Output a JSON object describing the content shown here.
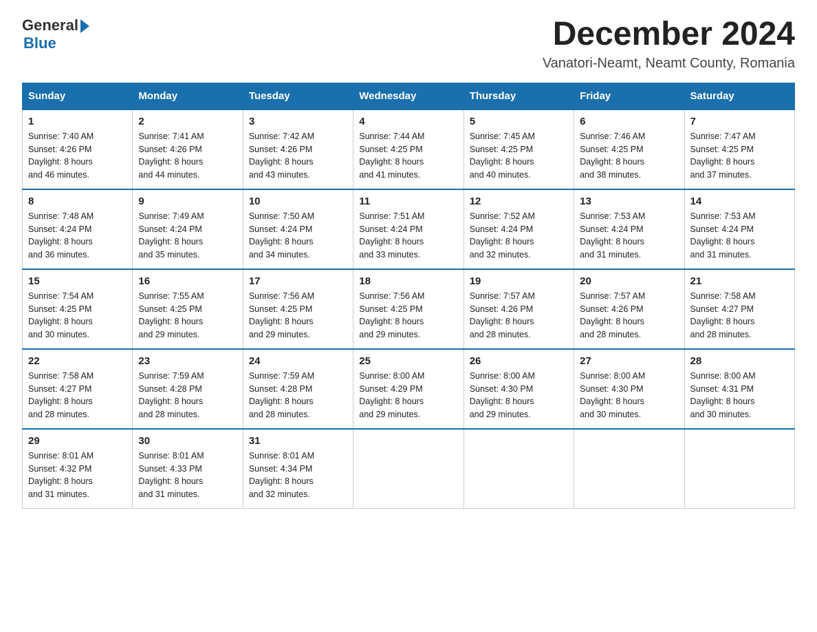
{
  "logo": {
    "text_general": "General",
    "arrow": "▶",
    "text_blue": "Blue"
  },
  "title": "December 2024",
  "subtitle": "Vanatori-Neamt, Neamt County, Romania",
  "days_of_week": [
    "Sunday",
    "Monday",
    "Tuesday",
    "Wednesday",
    "Thursday",
    "Friday",
    "Saturday"
  ],
  "weeks": [
    [
      {
        "day": "1",
        "info": "Sunrise: 7:40 AM\nSunset: 4:26 PM\nDaylight: 8 hours\nand 46 minutes."
      },
      {
        "day": "2",
        "info": "Sunrise: 7:41 AM\nSunset: 4:26 PM\nDaylight: 8 hours\nand 44 minutes."
      },
      {
        "day": "3",
        "info": "Sunrise: 7:42 AM\nSunset: 4:26 PM\nDaylight: 8 hours\nand 43 minutes."
      },
      {
        "day": "4",
        "info": "Sunrise: 7:44 AM\nSunset: 4:25 PM\nDaylight: 8 hours\nand 41 minutes."
      },
      {
        "day": "5",
        "info": "Sunrise: 7:45 AM\nSunset: 4:25 PM\nDaylight: 8 hours\nand 40 minutes."
      },
      {
        "day": "6",
        "info": "Sunrise: 7:46 AM\nSunset: 4:25 PM\nDaylight: 8 hours\nand 38 minutes."
      },
      {
        "day": "7",
        "info": "Sunrise: 7:47 AM\nSunset: 4:25 PM\nDaylight: 8 hours\nand 37 minutes."
      }
    ],
    [
      {
        "day": "8",
        "info": "Sunrise: 7:48 AM\nSunset: 4:24 PM\nDaylight: 8 hours\nand 36 minutes."
      },
      {
        "day": "9",
        "info": "Sunrise: 7:49 AM\nSunset: 4:24 PM\nDaylight: 8 hours\nand 35 minutes."
      },
      {
        "day": "10",
        "info": "Sunrise: 7:50 AM\nSunset: 4:24 PM\nDaylight: 8 hours\nand 34 minutes."
      },
      {
        "day": "11",
        "info": "Sunrise: 7:51 AM\nSunset: 4:24 PM\nDaylight: 8 hours\nand 33 minutes."
      },
      {
        "day": "12",
        "info": "Sunrise: 7:52 AM\nSunset: 4:24 PM\nDaylight: 8 hours\nand 32 minutes."
      },
      {
        "day": "13",
        "info": "Sunrise: 7:53 AM\nSunset: 4:24 PM\nDaylight: 8 hours\nand 31 minutes."
      },
      {
        "day": "14",
        "info": "Sunrise: 7:53 AM\nSunset: 4:24 PM\nDaylight: 8 hours\nand 31 minutes."
      }
    ],
    [
      {
        "day": "15",
        "info": "Sunrise: 7:54 AM\nSunset: 4:25 PM\nDaylight: 8 hours\nand 30 minutes."
      },
      {
        "day": "16",
        "info": "Sunrise: 7:55 AM\nSunset: 4:25 PM\nDaylight: 8 hours\nand 29 minutes."
      },
      {
        "day": "17",
        "info": "Sunrise: 7:56 AM\nSunset: 4:25 PM\nDaylight: 8 hours\nand 29 minutes."
      },
      {
        "day": "18",
        "info": "Sunrise: 7:56 AM\nSunset: 4:25 PM\nDaylight: 8 hours\nand 29 minutes."
      },
      {
        "day": "19",
        "info": "Sunrise: 7:57 AM\nSunset: 4:26 PM\nDaylight: 8 hours\nand 28 minutes."
      },
      {
        "day": "20",
        "info": "Sunrise: 7:57 AM\nSunset: 4:26 PM\nDaylight: 8 hours\nand 28 minutes."
      },
      {
        "day": "21",
        "info": "Sunrise: 7:58 AM\nSunset: 4:27 PM\nDaylight: 8 hours\nand 28 minutes."
      }
    ],
    [
      {
        "day": "22",
        "info": "Sunrise: 7:58 AM\nSunset: 4:27 PM\nDaylight: 8 hours\nand 28 minutes."
      },
      {
        "day": "23",
        "info": "Sunrise: 7:59 AM\nSunset: 4:28 PM\nDaylight: 8 hours\nand 28 minutes."
      },
      {
        "day": "24",
        "info": "Sunrise: 7:59 AM\nSunset: 4:28 PM\nDaylight: 8 hours\nand 28 minutes."
      },
      {
        "day": "25",
        "info": "Sunrise: 8:00 AM\nSunset: 4:29 PM\nDaylight: 8 hours\nand 29 minutes."
      },
      {
        "day": "26",
        "info": "Sunrise: 8:00 AM\nSunset: 4:30 PM\nDaylight: 8 hours\nand 29 minutes."
      },
      {
        "day": "27",
        "info": "Sunrise: 8:00 AM\nSunset: 4:30 PM\nDaylight: 8 hours\nand 30 minutes."
      },
      {
        "day": "28",
        "info": "Sunrise: 8:00 AM\nSunset: 4:31 PM\nDaylight: 8 hours\nand 30 minutes."
      }
    ],
    [
      {
        "day": "29",
        "info": "Sunrise: 8:01 AM\nSunset: 4:32 PM\nDaylight: 8 hours\nand 31 minutes."
      },
      {
        "day": "30",
        "info": "Sunrise: 8:01 AM\nSunset: 4:33 PM\nDaylight: 8 hours\nand 31 minutes."
      },
      {
        "day": "31",
        "info": "Sunrise: 8:01 AM\nSunset: 4:34 PM\nDaylight: 8 hours\nand 32 minutes."
      },
      null,
      null,
      null,
      null
    ]
  ]
}
